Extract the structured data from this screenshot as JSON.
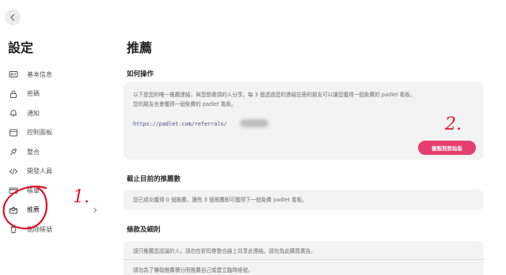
{
  "sidebar": {
    "title": "設定",
    "items": [
      {
        "label": "基本信息",
        "icon": "id-card-icon"
      },
      {
        "label": "密碼",
        "icon": "lock-icon"
      },
      {
        "label": "通知",
        "icon": "bell-icon"
      },
      {
        "label": "控制面板",
        "icon": "dashboard-icon"
      },
      {
        "label": "整合",
        "icon": "plug-icon"
      },
      {
        "label": "開發人員",
        "icon": "code-icon"
      },
      {
        "label": "帳單",
        "icon": "card-icon"
      },
      {
        "label": "推薦",
        "icon": "gift-icon"
      },
      {
        "label": "刪除帳號",
        "icon": "trash-icon"
      }
    ]
  },
  "main": {
    "title": "推薦",
    "how_to": {
      "heading": "如何操作",
      "line1": "以下是您的唯一推薦連結，與您想邀請的人分享。每 3 個透過您的連結註冊的朋友可以讓您獲得一個免費的 padlet 看板，",
      "line2": "您的朋友也會獲得一個免費的 padlet 看板。",
      "link": "https://padlet.com/referrals/",
      "copy_button": "複製到剪貼板"
    },
    "status": {
      "heading": "截止目前的推薦數",
      "text": "您已成功獲得 0 個推薦，還有 3 個推薦即可獲得下一個免費 padlet 看板。"
    },
    "terms": {
      "heading": "條款及細則",
      "rows": [
        "請只推薦您認識的人。請勿在折扣券整合器上共享此連結。請勿為此購買廣告。",
        "請勿為了賺取推薦積分而推薦自己或建立臨時帳號。"
      ]
    }
  },
  "annotations": {
    "mark1": "1.",
    "mark2": "2."
  },
  "colors": {
    "accent": "#e53e6f",
    "annotation_red": "#e0122a",
    "card_bg": "#f3f3f3"
  }
}
